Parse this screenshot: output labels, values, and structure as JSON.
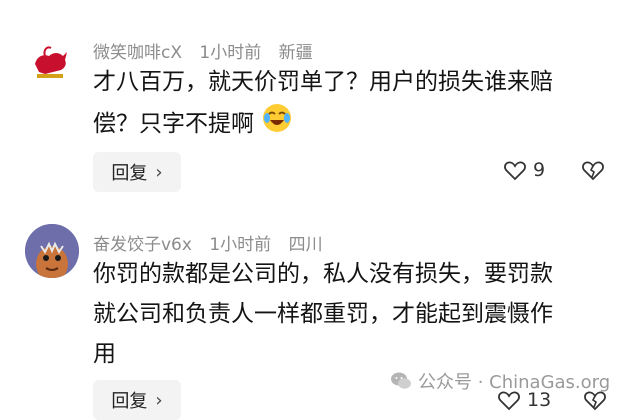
{
  "comments": [
    {
      "username": "微笑咖啡cX",
      "time": "1小时前",
      "location": "新疆",
      "text_line1": "才八百万，就天价罚单了？用户的损失谁来赔",
      "text_line2": "偿？只字不提啊",
      "emoji": "crying-laughing-emoji",
      "reply_label": "回复",
      "like_count": "9"
    },
    {
      "username": "奋发饺子v6x",
      "time": "1小时前",
      "location": "四川",
      "text_line1": "你罚的款都是公司的，私人没有损失，要罚款",
      "text_line2": "就公司和负责人一样都重罚，才能起到震慑作",
      "text_line3": "用",
      "reply_label": "回复",
      "like_count": "13"
    }
  ],
  "watermark": {
    "label": "公众号 · ChinaGas.org",
    "icon": "wechat-icon"
  }
}
